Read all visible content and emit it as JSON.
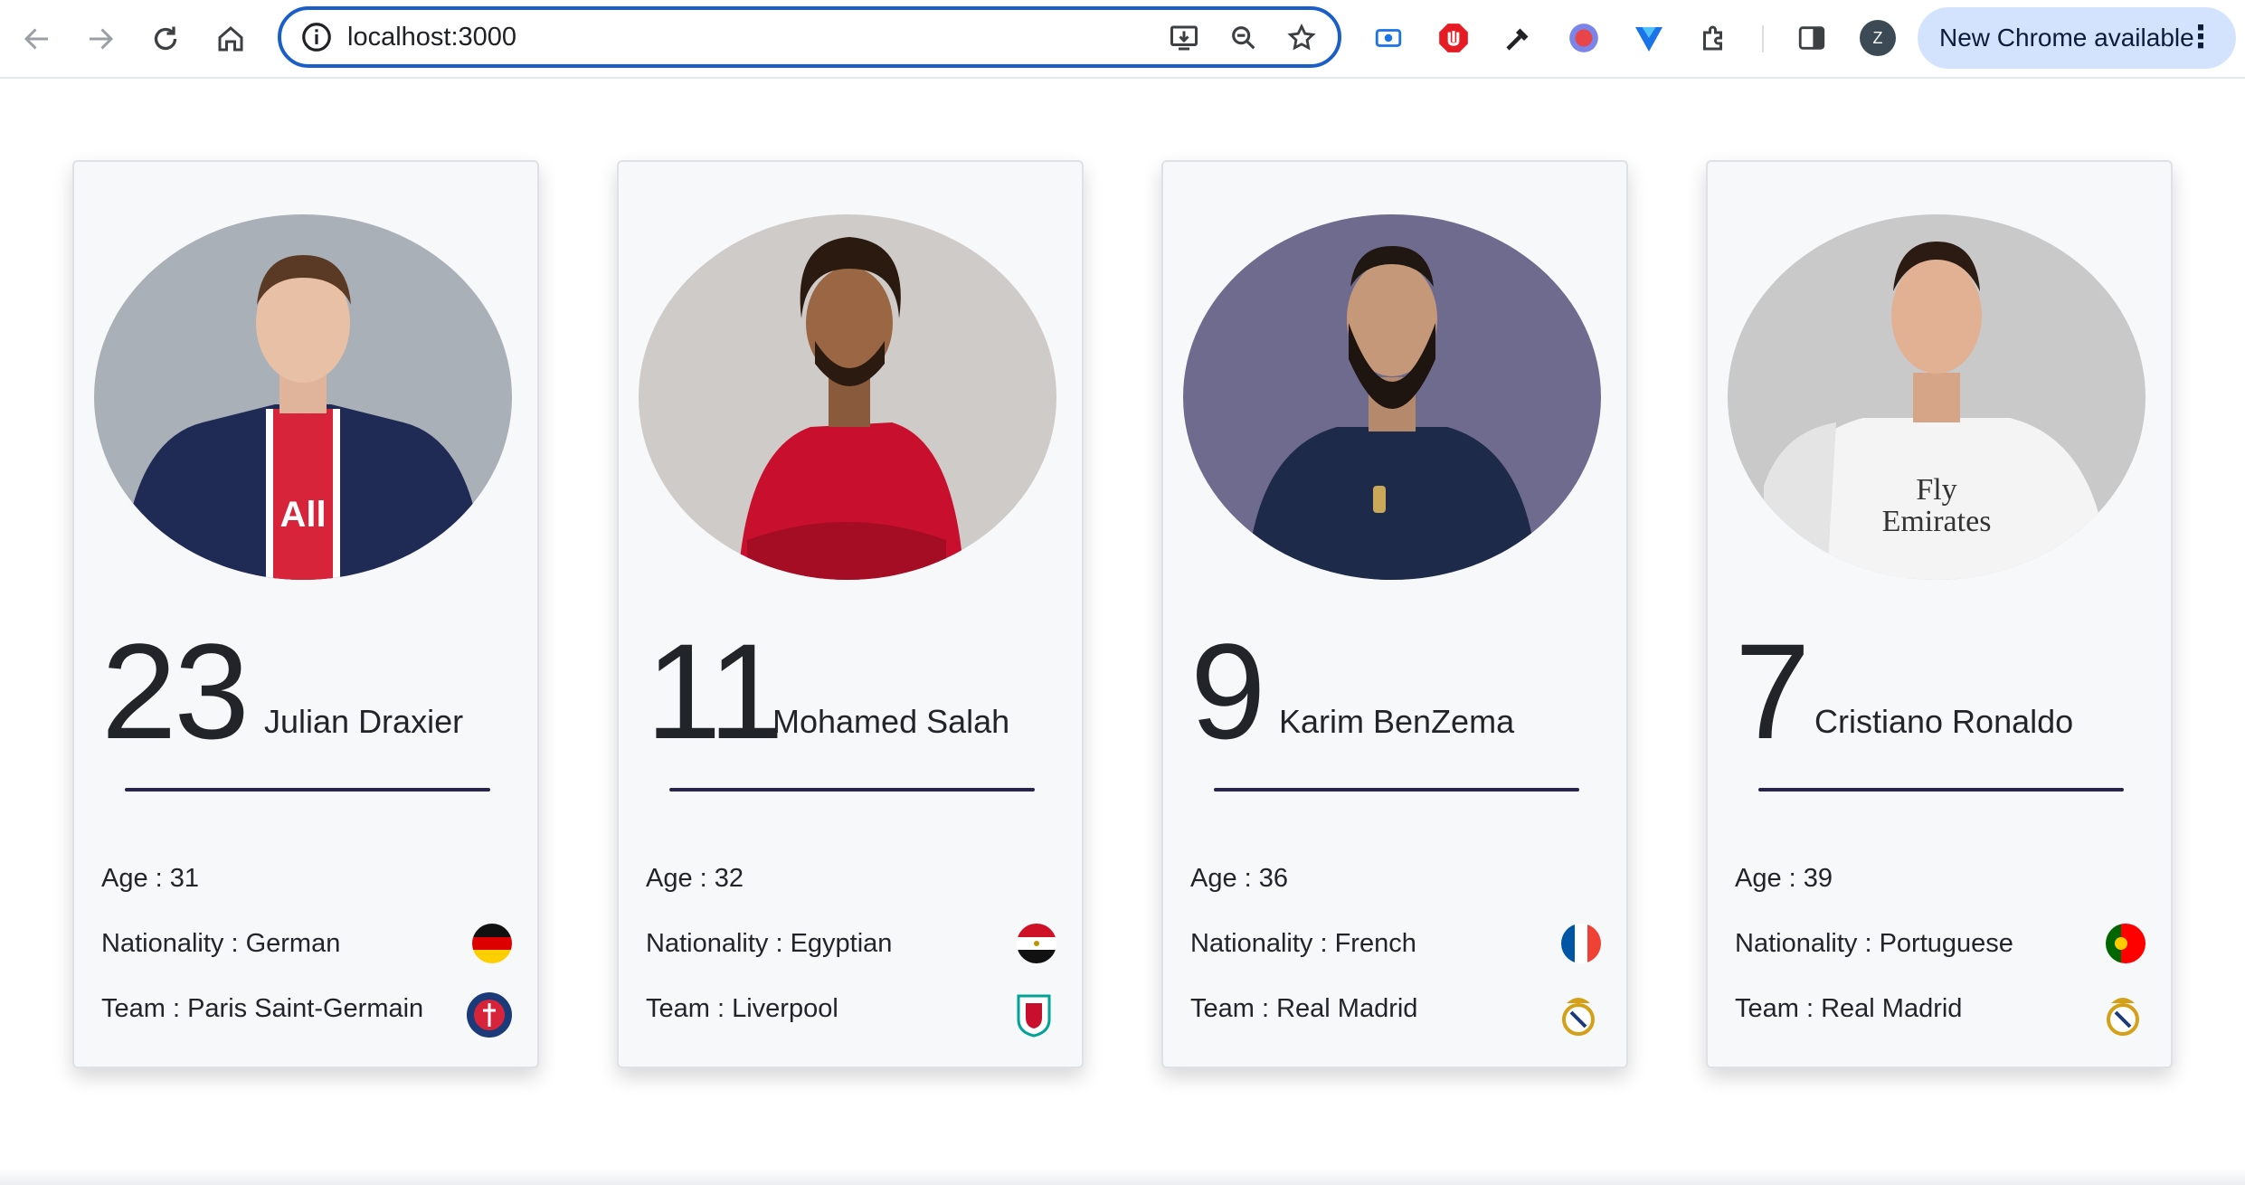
{
  "browser": {
    "url": "localhost:3000",
    "update_label": "New Chrome available",
    "profile_initial": "Z"
  },
  "players": [
    {
      "number": "23",
      "name": "Julian Draxier",
      "age": "Age : 31",
      "nationality": "Nationality : German",
      "team": "Team : Paris Saint-Germain",
      "flag": "germany-flag-icon",
      "crest": "psg-crest-icon"
    },
    {
      "number": "11",
      "name": "Mohamed Salah",
      "age": "Age : 32",
      "nationality": "Nationality : Egyptian",
      "team": "Team : Liverpool",
      "flag": "egypt-flag-icon",
      "crest": "liverpool-crest-icon"
    },
    {
      "number": "9",
      "name": "Karim BenZema",
      "age": "Age : 36",
      "nationality": "Nationality : French",
      "team": "Team : Real Madrid",
      "flag": "france-flag-icon",
      "crest": "real-madrid-crest-icon"
    },
    {
      "number": "7",
      "name": "Cristiano Ronaldo",
      "age": "Age : 39",
      "nationality": "Nationality : Portuguese",
      "team": "Team : Real Madrid",
      "flag": "portugal-flag-icon",
      "crest": "real-madrid-crest-icon"
    }
  ],
  "colors": {
    "card_bg": "#f7f8fa",
    "divider": "#27254f",
    "omnibox_border": "#1a5fc8",
    "update_pill": "#d3e3fd"
  }
}
